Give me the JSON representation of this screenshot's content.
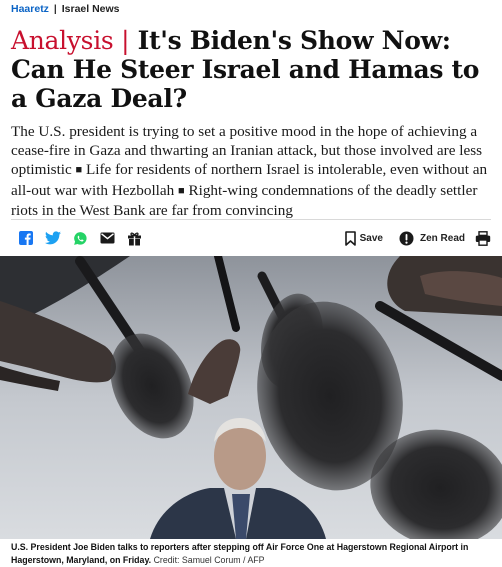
{
  "header": {
    "brand": "Haaretz",
    "separator": "|",
    "section": "Israel News"
  },
  "article": {
    "kicker": "Analysis |",
    "title": "It's Biden's Show Now: Can He Steer Israel and Hamas to a Gaza Deal?",
    "dek": {
      "part1": "The U.S. president is trying to set a positive mood in the hope of achieving a cease-fire in Gaza and thwarting an Iranian attack, but those involved are less optimistic",
      "part2": "Life for residents of northern Israel is intolerable, even without an all-out war with Hezbollah",
      "part3": "Right-wing condemnations of the deadly settler riots in the West Bank are far from convincing",
      "bullet": "■"
    }
  },
  "share_bar": {
    "icons": [
      "facebook-icon",
      "twitter-icon",
      "whatsapp-icon",
      "email-icon",
      "gift-icon"
    ],
    "save_label": "Save",
    "zen_label": "Zen Read",
    "print_icon": "printer-icon"
  },
  "photo": {
    "caption": "U.S. President Joe Biden talks to reporters after stepping off Air Force One at Hagerstown Regional Airport in Hagerstown, Maryland, on Friday.",
    "credit": "Credit: Samuel Corum / AFP"
  },
  "colors": {
    "brand": "#0b64c6",
    "kicker": "#c8102e",
    "facebook": "#1877f2",
    "twitter": "#1da1f2",
    "whatsapp": "#25d366"
  }
}
